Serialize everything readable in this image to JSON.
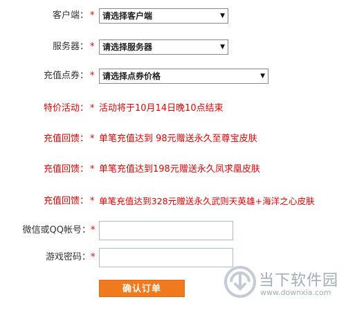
{
  "form": {
    "client": {
      "label": "客户端：",
      "star": "*",
      "value": "请选择客户端"
    },
    "server": {
      "label": "服务器：",
      "star": "*",
      "value": "请选择服务器"
    },
    "points": {
      "label": "充值点券：",
      "star": "*",
      "value": "请选择点券价格"
    },
    "promo": {
      "label": "特价活动：",
      "star": "*",
      "text": "活动将于10月14日晚10点结束"
    },
    "rewards": [
      {
        "label": "充值回馈：",
        "star": "*",
        "text": "单笔充值达到 98元赠送永久至尊宝皮肤"
      },
      {
        "label": "充值回馈：",
        "star": "*",
        "text": "单笔充值达到198元赠送永久凤求凰皮肤"
      },
      {
        "label": "充值回馈：",
        "star": "*",
        "text": "单笔充值达到328元赠送永久武则天英雄+海洋之心皮肤"
      }
    ],
    "account": {
      "label": "微信或QQ帐号：",
      "star": "*",
      "value": ""
    },
    "password": {
      "label": "游戏密码：",
      "star": "*",
      "value": ""
    },
    "submit_label": "确认订单"
  },
  "watermark": {
    "title": "当下软件园",
    "url": "www.downxia.com"
  },
  "colors": {
    "accent": "#e60000",
    "button": "#f07a1d"
  },
  "icons": {
    "dropdown": "chevron-down-icon",
    "watermark_logo": "downxia-logo-icon"
  }
}
